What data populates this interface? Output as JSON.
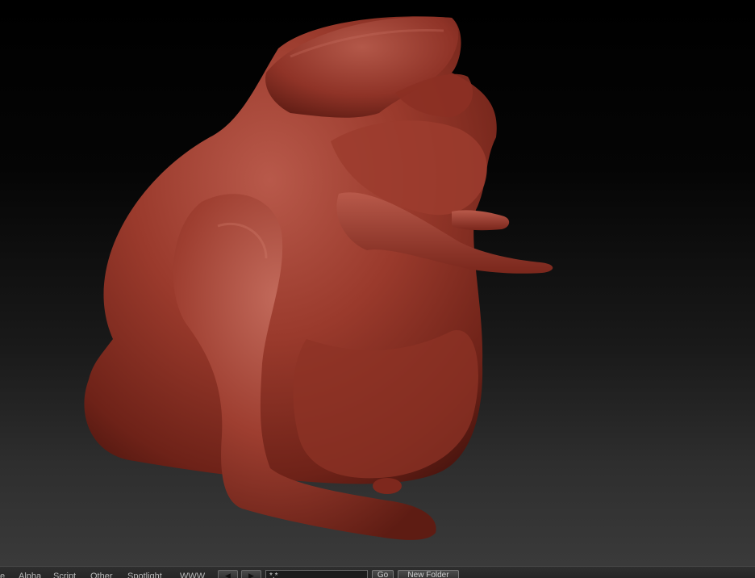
{
  "lightbox": {
    "tabs": [
      {
        "label": "e"
      },
      {
        "label": "Alpha"
      },
      {
        "label": "Script"
      },
      {
        "label": "Other"
      },
      {
        "label": "Spotlight"
      },
      {
        "label": "WWW"
      }
    ],
    "search_value": "*.*",
    "go_label": "Go",
    "new_folder_label": "New Folder"
  },
  "colors": {
    "model": "#9a3a2c",
    "bar": "#2a2a2a"
  }
}
